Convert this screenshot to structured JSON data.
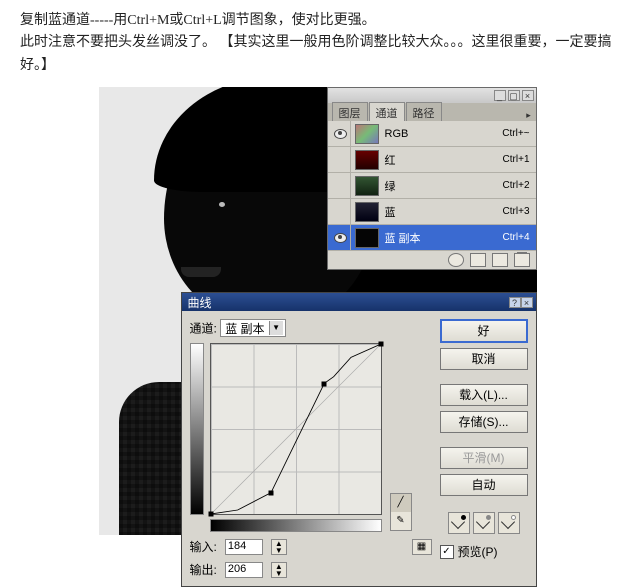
{
  "instructions": {
    "line1": "复制蓝通道-----用Ctrl+M或Ctrl+L调节图象，使对比更强。",
    "line2": "此时注意不要把头发丝调没了。 【其实这里一般用色阶调整比较大众。。。这里很重要，一定要搞好。】"
  },
  "channels_panel": {
    "tabs": {
      "layers": "图层",
      "channels": "通道",
      "paths": "路径"
    },
    "rows": [
      {
        "name": "RGB",
        "shortcut": "Ctrl+~",
        "eye": true,
        "thumb": "rgb"
      },
      {
        "name": "红",
        "shortcut": "Ctrl+1",
        "eye": false,
        "thumb": "red"
      },
      {
        "name": "绿",
        "shortcut": "Ctrl+2",
        "eye": false,
        "thumb": "green"
      },
      {
        "name": "蓝",
        "shortcut": "Ctrl+3",
        "eye": false,
        "thumb": "blue"
      },
      {
        "name": "蓝 副本",
        "shortcut": "Ctrl+4",
        "eye": true,
        "thumb": "bluecopy",
        "selected": true
      }
    ]
  },
  "curves_dialog": {
    "title": "曲线",
    "channel_label": "通道:",
    "channel_value": "蓝 副本",
    "input_label": "输入:",
    "input_value": "184",
    "output_label": "输出:",
    "output_value": "206",
    "buttons": {
      "ok": "好",
      "cancel": "取消",
      "load": "载入(L)...",
      "save": "存储(S)...",
      "smooth": "平滑(M)",
      "auto": "自动"
    },
    "preview_label": "预览(P)",
    "preview_checked": true
  },
  "chart_data": {
    "type": "line",
    "title": "曲线 (蓝 副本)",
    "xlabel": "输入",
    "ylabel": "输出",
    "xlim": [
      0,
      255
    ],
    "ylim": [
      0,
      255
    ],
    "series": [
      {
        "name": "curve",
        "x": [
          0,
          40,
          90,
          128,
          170,
          184,
          210,
          255
        ],
        "values": [
          0,
          6,
          32,
          110,
          196,
          206,
          235,
          255
        ]
      }
    ],
    "control_points": [
      {
        "x": 0,
        "y": 0
      },
      {
        "x": 90,
        "y": 32
      },
      {
        "x": 170,
        "y": 196
      },
      {
        "x": 255,
        "y": 255
      }
    ]
  }
}
